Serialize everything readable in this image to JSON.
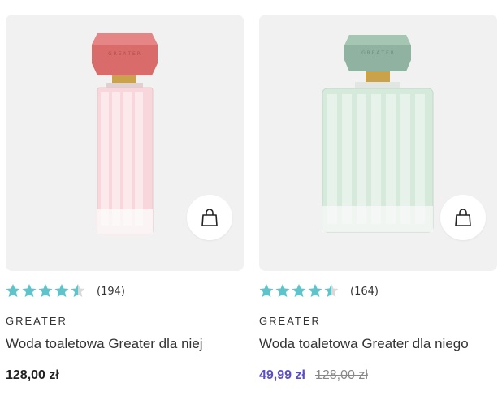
{
  "products": [
    {
      "rating_value": 4.5,
      "rating_count": "(194)",
      "brand": "GREATER",
      "title": "Woda toaletowa Greater dla niej",
      "price": "128,00 zł",
      "sale_price": "",
      "old_price": "",
      "cap_color": "#d96b6b",
      "liquid_color": "#f7d6dc",
      "icon": "shopping-bag-icon"
    },
    {
      "rating_value": 4.5,
      "rating_count": "(164)",
      "brand": "GREATER",
      "title": "Woda toaletowa Greater dla niego",
      "price": "",
      "sale_price": "49,99 zł",
      "old_price": "128,00 zł",
      "cap_color": "#8fb3a0",
      "liquid_color": "#d5eadb",
      "icon": "shopping-bag-icon"
    }
  ],
  "colors": {
    "star": "#5fc3c9",
    "star_empty": "#d9d9d9",
    "sale": "#5a4fc4"
  }
}
